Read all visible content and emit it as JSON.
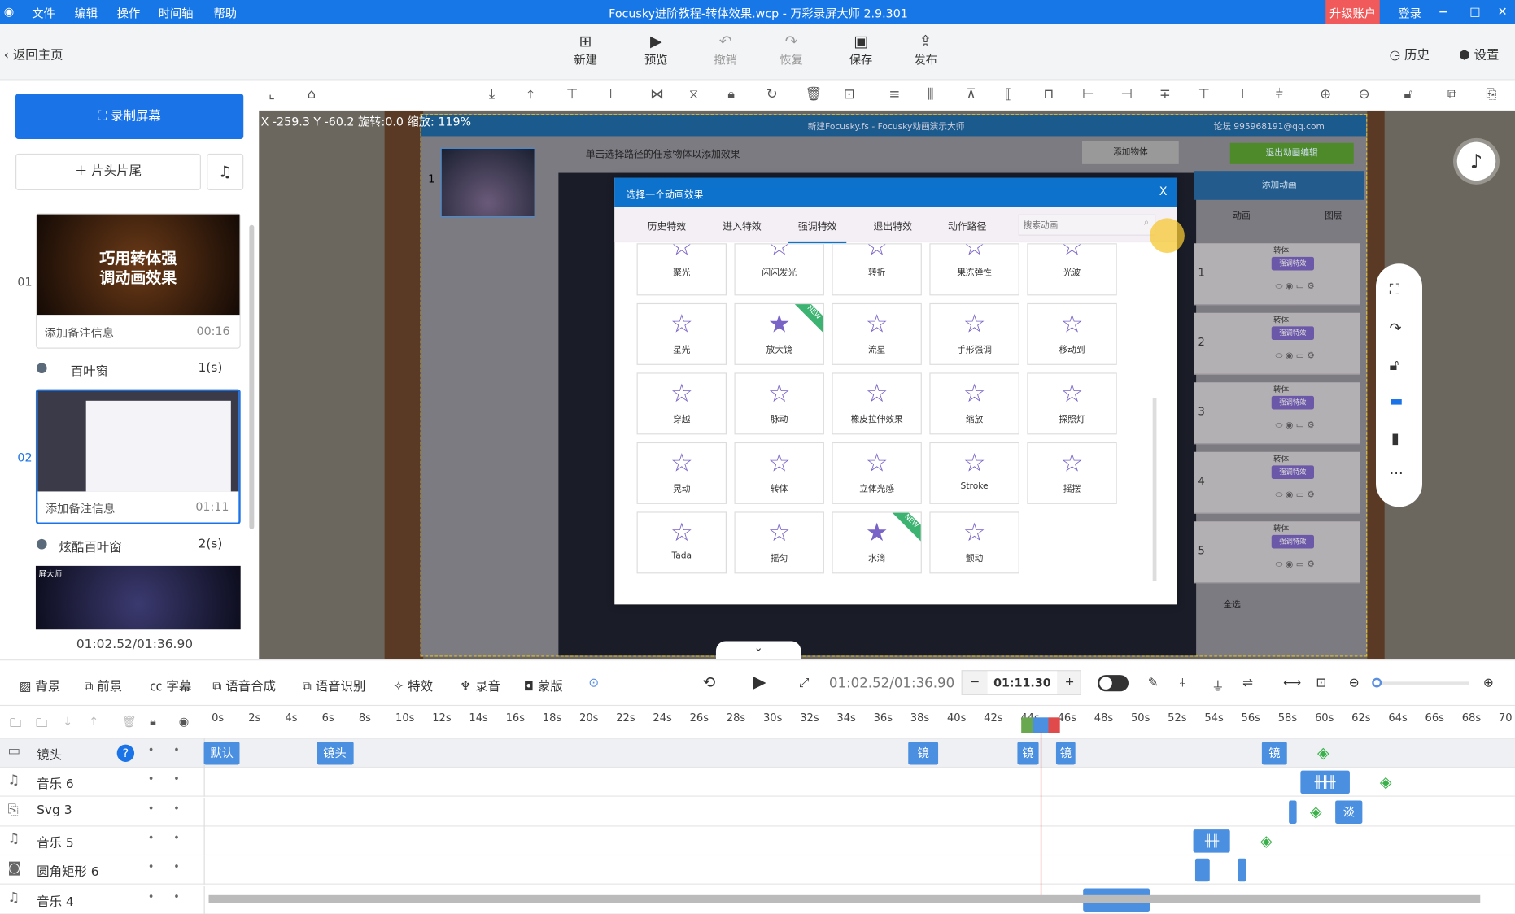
{
  "titlebar": {
    "logo": "◉",
    "menus": [
      "文件",
      "编辑",
      "操作",
      "时间轴",
      "帮助"
    ],
    "title": "Focusky进阶教程-转体效果.wcp - 万彩录屏大师 2.9.301",
    "upgrade": "升级账户",
    "login": "登录",
    "minimize": "━",
    "maximize": "□",
    "close": "✕",
    "upgrade_color": "#f05a5a"
  },
  "toolbar": {
    "back": "返回主页",
    "items": [
      {
        "label": "新建",
        "icon": "plus-square"
      },
      {
        "label": "预览",
        "icon": "play"
      },
      {
        "label": "撤销",
        "icon": "undo",
        "disabled": true
      },
      {
        "label": "恢复",
        "icon": "redo",
        "disabled": true
      },
      {
        "label": "保存",
        "icon": "save"
      },
      {
        "label": "发布",
        "icon": "publish"
      }
    ],
    "history": "历史",
    "settings": "设置"
  },
  "left": {
    "record": "录制屏幕",
    "intro_outro": "片头片尾",
    "scenes": [
      {
        "num": "01",
        "thumb_text": "巧用转体强\n调动画效果",
        "note": "添加备注信息",
        "time": "00:16"
      },
      {
        "num": "02",
        "note": "添加备注信息",
        "time": "01:11",
        "selected": true
      }
    ],
    "transitions": [
      {
        "name": "百叶窗",
        "dur": "1(s)"
      },
      {
        "name": "炫酷百叶窗",
        "dur": "2(s)"
      }
    ],
    "scene3_text": "屏大师",
    "total_time": "01:02.52/01:36.90"
  },
  "canvas": {
    "coords": "X -259.3 Y -60.2 旋转:0.0 缩放: 119%",
    "inner_title": "新建Focusky.fs - Focusky动画演示大师",
    "inner_account": "论坛   995968191@qq.com",
    "hint": "单击选择路径的任意物体以添加效果",
    "add_object": "添加物体",
    "exit_anim": "退出动画编辑",
    "add_anim": "添加动画",
    "panel_tabs": [
      "动画",
      "图层"
    ],
    "anim_items": [
      {
        "n": "1",
        "name": "转体",
        "tag": "强调特效"
      },
      {
        "n": "2",
        "name": "转体",
        "tag": "强调特效"
      },
      {
        "n": "3",
        "name": "转体",
        "tag": "强调特效"
      },
      {
        "n": "4",
        "name": "转体",
        "tag": "强调特效"
      },
      {
        "n": "5",
        "name": "转体",
        "tag": "强调特效"
      }
    ],
    "select_all": "全选",
    "marker4": "4",
    "slide_num": "1"
  },
  "dialog": {
    "title": "选择一个动画效果",
    "close": "X",
    "tabs": [
      "历史特效",
      "进入特效",
      "强调特效",
      "退出特效",
      "动作路径"
    ],
    "active_tab": 2,
    "search_placeholder": "搜索动画",
    "effects": [
      {
        "label": "聚光"
      },
      {
        "label": "闪闪发光"
      },
      {
        "label": "转折"
      },
      {
        "label": "果冻弹性"
      },
      {
        "label": "光波"
      },
      {
        "label": "星光"
      },
      {
        "label": "放大镜",
        "new": true,
        "filled": true
      },
      {
        "label": "流星"
      },
      {
        "label": "手形强调"
      },
      {
        "label": "移动到"
      },
      {
        "label": "穿越"
      },
      {
        "label": "脉动"
      },
      {
        "label": "橡皮拉伸效果"
      },
      {
        "label": "缩放"
      },
      {
        "label": "探照灯"
      },
      {
        "label": "晃动"
      },
      {
        "label": "转体"
      },
      {
        "label": "立体光感"
      },
      {
        "label": "Stroke"
      },
      {
        "label": "摇摆"
      },
      {
        "label": "Tada"
      },
      {
        "label": "摇匀"
      },
      {
        "label": "水滴",
        "new": true,
        "filled": true
      },
      {
        "label": "颤动"
      }
    ],
    "new_tag": "NEW"
  },
  "timeline": {
    "tools": [
      "背景",
      "前景",
      "字幕",
      "语音合成",
      "语音识别",
      "特效",
      "录音",
      "蒙版"
    ],
    "time": "01:02.52/01:36.90",
    "duration": "01:11.30",
    "minus": "−",
    "plus": "+",
    "ticks": [
      "0s",
      "2s",
      "4s",
      "6s",
      "8s",
      "10s",
      "12s",
      "14s",
      "16s",
      "18s",
      "20s",
      "22s",
      "24s",
      "26s",
      "28s",
      "30s",
      "32s",
      "34s",
      "36s",
      "38s",
      "40s",
      "42s",
      "44s",
      "46s",
      "48s",
      "50s",
      "52s",
      "54s",
      "56s",
      "58s",
      "60s",
      "62s",
      "64s",
      "66s",
      "68s",
      "70"
    ],
    "playhead_s": 45,
    "tracks": [
      {
        "name": "镜头",
        "icon": "camera",
        "clips": [
          {
            "s": -0.5,
            "e": 1.4,
            "label": "默认"
          },
          {
            "s": 5.6,
            "e": 7.6,
            "label": "镜头"
          },
          {
            "s": 37.8,
            "e": 39.4,
            "label": "镜"
          },
          {
            "s": 43.7,
            "e": 44.9,
            "label": "镜"
          },
          {
            "s": 45.8,
            "e": 46.9,
            "label": "镜"
          },
          {
            "s": 57,
            "e": 58.4,
            "label": "镜"
          }
        ],
        "diamonds": [
          60.4
        ]
      },
      {
        "name": "音乐 6",
        "icon": "music",
        "clips": [
          {
            "s": 59.1,
            "e": 61.8,
            "label": "╫╫╫"
          }
        ],
        "diamonds": [
          63.8
        ]
      },
      {
        "name": "Svg 3",
        "icon": "svg",
        "clips": [
          {
            "s": 58.5,
            "e": 58.9,
            "label": ""
          },
          {
            "s": 61,
            "e": 62.5,
            "label": "淡"
          }
        ],
        "diamonds": [
          60
        ]
      },
      {
        "name": "音乐 5",
        "icon": "music",
        "clips": [
          {
            "s": 53.3,
            "e": 55.3,
            "label": "╫╫"
          }
        ],
        "diamonds": [
          57.3
        ]
      },
      {
        "name": "圆角矩形 6",
        "icon": "shape",
        "clips": [
          {
            "s": 53.4,
            "e": 54.2,
            "label": ""
          },
          {
            "s": 55.7,
            "e": 56.2,
            "label": ""
          }
        ],
        "diamonds": []
      },
      {
        "name": "音乐 4",
        "icon": "music",
        "clips": [
          {
            "s": 47.3,
            "e": 50.9,
            "label": ""
          }
        ],
        "diamonds": []
      }
    ]
  }
}
